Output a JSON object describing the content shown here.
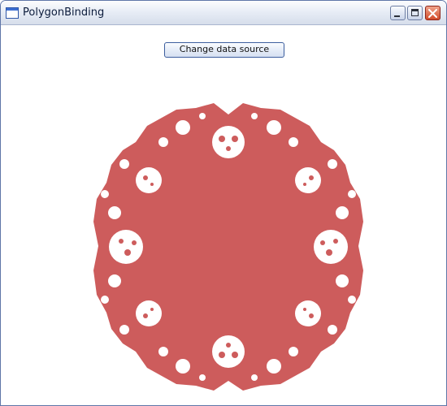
{
  "window": {
    "title": "PolygonBinding",
    "icon": "window-icon"
  },
  "controls": {
    "minimize_icon": "minimize-icon",
    "maximize_icon": "maximize-icon",
    "close_icon": "close-icon"
  },
  "toolbar": {
    "change_source_label": "Change data source"
  },
  "polygon": {
    "fill_color": "#cd5c5c",
    "background_color": "#ffffff"
  }
}
